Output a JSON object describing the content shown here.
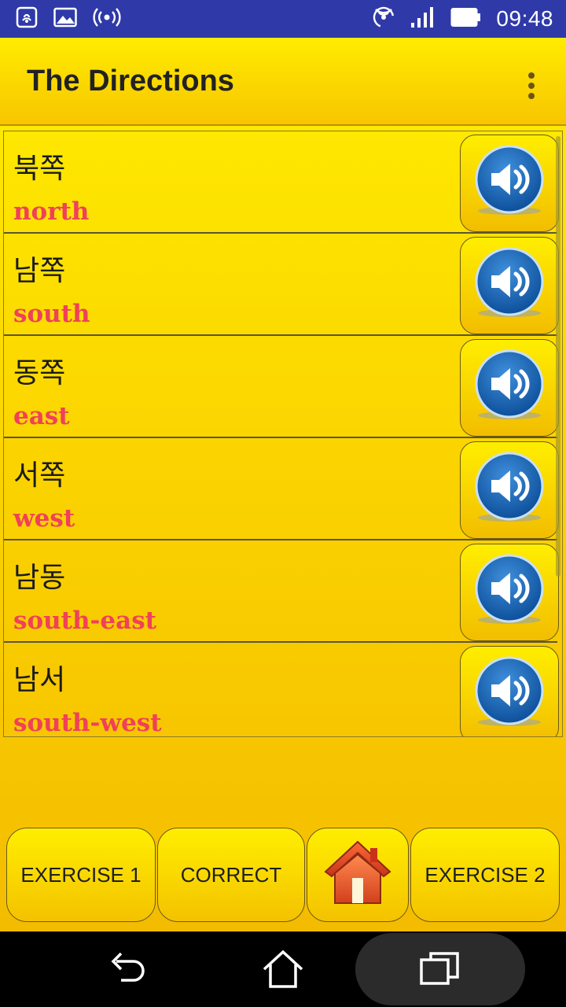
{
  "status_bar": {
    "time": "09:48",
    "left_icons": [
      "nfc-icon",
      "image-icon",
      "hotspot-icon"
    ],
    "right_icons": [
      "wifi-icon",
      "signal-icon",
      "battery-icon"
    ]
  },
  "app_bar": {
    "title": "The Directions"
  },
  "words": [
    {
      "korean": "북쪽",
      "english": "north"
    },
    {
      "korean": "남쪽",
      "english": "south"
    },
    {
      "korean": "동쪽",
      "english": "east"
    },
    {
      "korean": "서쪽",
      "english": "west"
    },
    {
      "korean": "남동",
      "english": "south-east"
    },
    {
      "korean": "남서",
      "english": "south-west"
    }
  ],
  "bottom_buttons": {
    "exercise1": "EXERCISE 1",
    "correct": "CORRECT",
    "exercise2": "EXERCISE 2"
  },
  "colors": {
    "status_bar": "#2f3aa8",
    "english_text": "#f0405a",
    "speaker_blue": "#1f6fc0"
  }
}
